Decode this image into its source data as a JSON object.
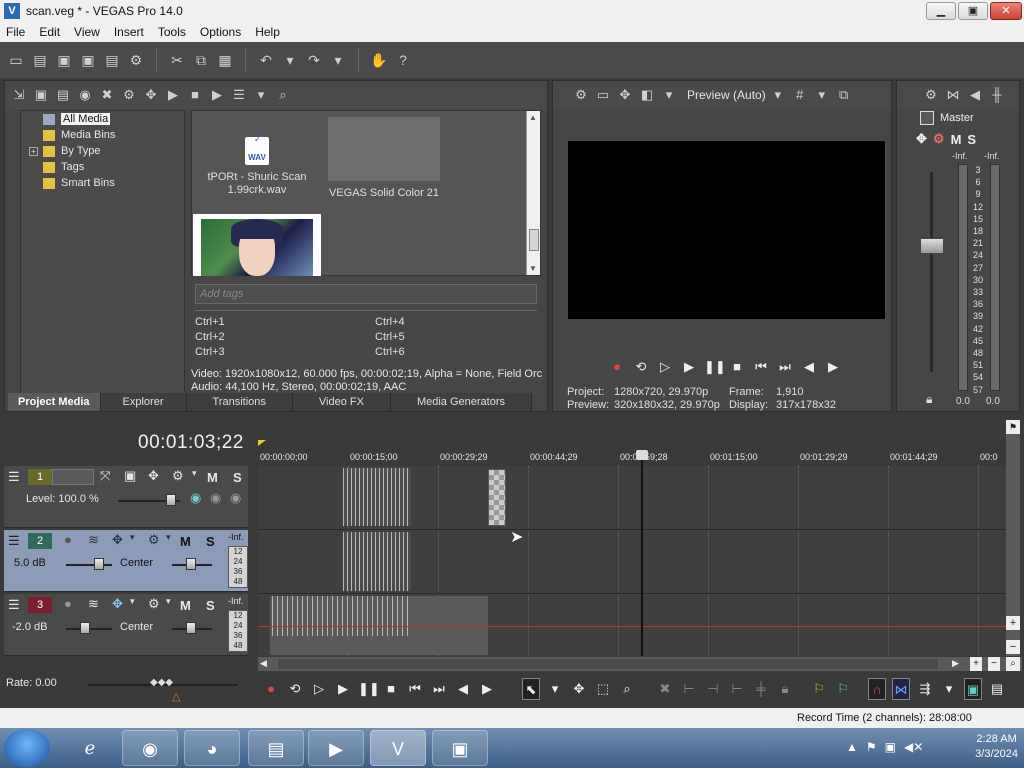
{
  "window": {
    "title": "scan.veg * - VEGAS Pro 14.0",
    "app_icon": "vegas-logo-icon",
    "min_label": "▁",
    "max_label": "▣",
    "close_label": "✕"
  },
  "menu": [
    "File",
    "Edit",
    "View",
    "Insert",
    "Tools",
    "Options",
    "Help"
  ],
  "project_media": {
    "tree": [
      {
        "label": "All Media",
        "selected": true
      },
      {
        "label": "Media Bins",
        "selected": false
      },
      {
        "label": "By Type",
        "selected": false,
        "expandable": true
      },
      {
        "label": "Tags",
        "selected": false
      },
      {
        "label": "Smart Bins",
        "selected": false
      }
    ],
    "items": [
      {
        "label": "tPORt - Shuric Scan 1.99crk.wav",
        "kind": "wav"
      },
      {
        "label": "VEGAS Solid Color 21",
        "kind": "solid"
      }
    ],
    "wav_badge": "WAV",
    "tags_placeholder": "Add tags",
    "shortcuts": [
      "Ctrl+1",
      "Ctrl+2",
      "Ctrl+3",
      "Ctrl+4",
      "Ctrl+5",
      "Ctrl+6"
    ],
    "info_video": "Video: 1920x1080x12, 60.000 fps, 00:00:02;19, Alpha = None, Field Orc",
    "info_audio": "Audio: 44,100 Hz, Stereo, 00:00:02;19, AAC",
    "tabs": [
      "Project Media",
      "Explorer",
      "Transitions",
      "Video FX",
      "Media Generators"
    ]
  },
  "preview": {
    "mode": "Preview (Auto)",
    "project_label": "Project:",
    "project_value": "1280x720, 29.970p",
    "preview_label": "Preview:",
    "preview_value": "320x180x32, 29.970p",
    "frame_label": "Frame:",
    "frame_value": "1,910",
    "display_label": "Display:",
    "display_value": "317x178x32"
  },
  "master": {
    "label": "Master",
    "m_label": "M",
    "s_label": "S",
    "inf_left": "-Inf.",
    "inf_right": "-Inf.",
    "scale": [
      "3",
      "6",
      "9",
      "12",
      "15",
      "18",
      "21",
      "24",
      "27",
      "30",
      "33",
      "36",
      "39",
      "42",
      "45",
      "48",
      "51",
      "54",
      "57"
    ],
    "value_left": "0.0",
    "value_right": "0.0"
  },
  "timeline": {
    "timecode": "00:01:03;22",
    "ruler": [
      "00:00:00;00",
      "00:00:15;00",
      "00:00:29;29",
      "00:00:44;29",
      "00:00:59;28",
      "00:01:15;00",
      "00:01:29;29",
      "00:01:44;29",
      "00:0"
    ],
    "tracks": [
      {
        "number": "1",
        "type": "video",
        "level_label": "Level: 100.0 %",
        "m": "M",
        "s": "S"
      },
      {
        "number": "2",
        "type": "audio",
        "volume": "5.0 dB",
        "pan": "Center",
        "m": "M",
        "s": "S",
        "meter_inf": "-Inf.",
        "meter": [
          "12",
          "24",
          "36",
          "48"
        ]
      },
      {
        "number": "3",
        "type": "audio",
        "volume": "-2.0 dB",
        "pan": "Center",
        "m": "M",
        "s": "S",
        "meter_inf": "-Inf.",
        "meter": [
          "12",
          "24",
          "36",
          "48"
        ]
      }
    ],
    "rate": "Rate: 0.00",
    "record_time": "Record Time (2 channels): 28:08:00"
  },
  "taskbar": {
    "time": "2:28 AM",
    "date": "3/3/2024"
  }
}
